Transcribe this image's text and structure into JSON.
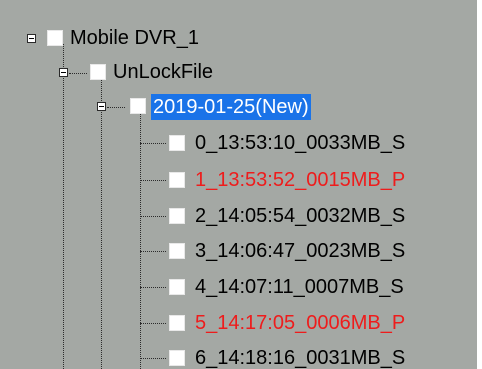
{
  "tree": {
    "device": {
      "label": "Mobile DVR_1",
      "expanded": true
    },
    "folder": {
      "label": "UnLockFile",
      "expanded": true
    },
    "date_node": {
      "label": "2019-01-25(New)",
      "expanded": true,
      "selected": true
    },
    "files": [
      {
        "label": "0_13:53:10_0033MB_S",
        "status": "normal"
      },
      {
        "label": "1_13:53:52_0015MB_P",
        "status": "protected"
      },
      {
        "label": "2_14:05:54_0032MB_S",
        "status": "normal"
      },
      {
        "label": "3_14:06:47_0023MB_S",
        "status": "normal"
      },
      {
        "label": "4_14:07:11_0007MB_S",
        "status": "normal"
      },
      {
        "label": "5_14:17:05_0006MB_P",
        "status": "protected"
      },
      {
        "label": "6_14:18:16_0031MB_S",
        "status": "normal"
      }
    ]
  },
  "colors": {
    "background": "#a4a8a4",
    "selection": "#1a73e8",
    "protected_text": "#ee1c1c",
    "normal_text": "#000000"
  },
  "icons": {
    "expander": "minus-box-icon",
    "checkbox": "checkbox-unchecked-icon"
  }
}
